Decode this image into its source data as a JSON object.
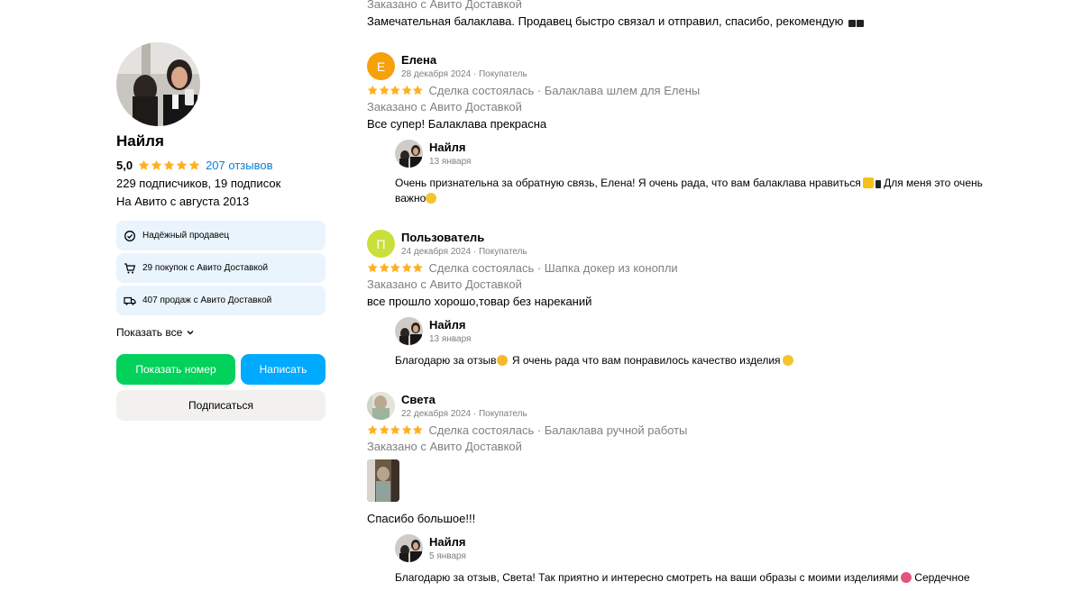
{
  "seller": {
    "name": "Найля",
    "rating": "5,0",
    "reviews_link": "207 отзывов",
    "followers": "229 подписчиков, 19 подписок",
    "since": "На Авито с августа 2013",
    "badges": [
      {
        "icon": "check-circle-icon",
        "label": "Надёжный продавец"
      },
      {
        "icon": "cart-icon",
        "label": "29 покупок с Авито Доставкой"
      },
      {
        "icon": "truck-icon",
        "label": "407 продаж с Авито Доставкой"
      }
    ],
    "show_all": "Показать все",
    "buttons": {
      "show_phone": "Показать номер",
      "write": "Написать",
      "subscribe": "Подписаться"
    }
  },
  "colors": {
    "accent_green": "#02d15c",
    "accent_blue": "#00aaff",
    "link": "#0a7fd6",
    "star": "#ffb021",
    "badge_bg": "#e9f4fd"
  },
  "reviews": {
    "top_partial": {
      "delivery": "Заказано с Авито Доставкой",
      "text": "Замечательная балаклава. Продавец быстро связал и отправил, спасибо, рекомендую"
    },
    "items": [
      {
        "initial": "Е",
        "avatar_color": "#f7a10a",
        "name": "Елена",
        "date": "28 декабря 2024 · Покупатель",
        "deal": "Сделка состоялась · Балаклава шлем для Елены",
        "delivery": "Заказано с Авито Доставкой",
        "text": "Все супер! Балаклава прекрасна",
        "reply": {
          "name": "Найля",
          "date": "13 января",
          "text": "Очень признательна за обратную связь, Елена! Я очень рада, что вам балаклава нравиться",
          "text_2": "Для меня это очень важно"
        }
      },
      {
        "initial": "П",
        "avatar_color": "#c9df3b",
        "name": "Пользователь",
        "date": "24 декабря 2024 · Покупатель",
        "deal": "Сделка состоялась · Шапка докер из конопли",
        "delivery": "Заказано с Авито Доставкой",
        "text": "все прошло хорошо,товар без нареканий",
        "reply": {
          "name": "Найля",
          "date": "13 января",
          "text": "Благодарю за отзыв",
          "text_2": "Я очень рада что вам понравилось качество изделия"
        }
      },
      {
        "initial": "",
        "avatar_color": "#d8d2c8",
        "name": "Света",
        "date": "22 декабря 2024 · Покупатель",
        "deal": "Сделка состоялась · Балаклава ручной работы",
        "delivery": "Заказано с Авито Доставкой",
        "text": "Спасибо большое!!!",
        "reply": {
          "name": "Найля",
          "date": "5 января",
          "text": "Благодарю за отзыв, Света! Так приятно и интересно смотреть на ваши образы с моими изделиями",
          "text_2": "Сердечное"
        }
      }
    ]
  }
}
